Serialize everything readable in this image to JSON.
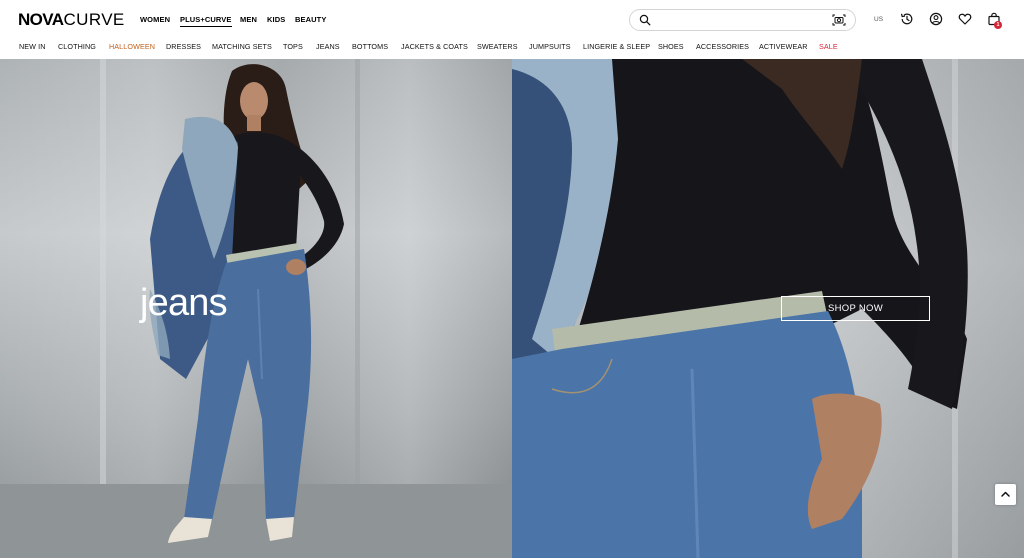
{
  "brand": {
    "logo_bold": "NOVA",
    "logo_light": "CURVE"
  },
  "departments": [
    {
      "label": "WOMEN",
      "active": false
    },
    {
      "label": "PLUS+CURVE",
      "active": true
    },
    {
      "label": "MEN",
      "active": false
    },
    {
      "label": "KIDS",
      "active": false
    },
    {
      "label": "BEAUTY",
      "active": false
    }
  ],
  "search": {
    "placeholder": ""
  },
  "header_icons": [
    "search-icon",
    "camera-icon",
    "history-icon",
    "account-icon",
    "heart-icon",
    "bag-icon"
  ],
  "region": "US",
  "cart": {
    "count": "1"
  },
  "categories": [
    "NEW IN",
    "CLOTHING",
    "HALLOWEEN",
    "DRESSES",
    "MATCHING SETS",
    "TOPS",
    "JEANS",
    "BOTTOMS",
    "JACKETS & COATS",
    "SWEATERS",
    "JUMPSUITS",
    "LINGERIE & SLEEP",
    "SHOES",
    "ACCESSORIES",
    "ACTIVEWEAR",
    "SALE"
  ],
  "hero": {
    "title": "jeans",
    "cta": "SHOP NOW"
  },
  "colors": {
    "accent_halloween": "#c0611a",
    "sale_red": "#d5263a",
    "denim": "#4a6f9e"
  }
}
